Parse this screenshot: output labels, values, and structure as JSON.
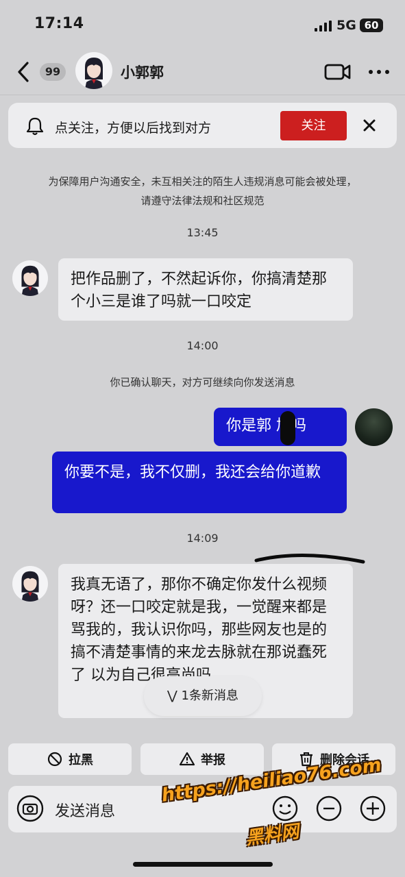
{
  "status_bar": {
    "time": "17:14",
    "network": "5G",
    "battery": "60"
  },
  "header": {
    "unread_count": "99",
    "contact_name": "小郭郭"
  },
  "follow_banner": {
    "text": "点关注，方便以后找到对方",
    "follow_label": "关注"
  },
  "notice": "为保障用户沟通安全，未互相关注的陌生人违规消息可能会被处理，请遵守法律法规和社区规范",
  "messages": [
    {
      "type": "time",
      "text": "13:45"
    },
    {
      "type": "incoming",
      "text": "把作品删了，不然起诉你，你搞清楚那个小三是谁了吗就一口咬定"
    },
    {
      "type": "time",
      "text": "14:00"
    },
    {
      "type": "system",
      "text": "你已确认聊天，对方可继续向你发送消息"
    },
    {
      "type": "outgoing",
      "text": "你是郭 旭吗"
    },
    {
      "type": "outgoing",
      "text": "你要不是，我不仅删，我还会给你道歉"
    },
    {
      "type": "time",
      "text": "14:09"
    },
    {
      "type": "incoming",
      "text": "我真无语了，那你不确定你发什么视频呀？还一口咬定就是我，一觉醒来都是骂我的，我认识你吗，那些网友也是的 搞不清楚事情的来龙去脉就在那说蠢死了  以为自己很高尚吗"
    }
  ],
  "new_messages_pill": "1条新消息",
  "actions": {
    "block": "拉黑",
    "report": "举报",
    "delete": "删除会话"
  },
  "input": {
    "placeholder": "发送消息"
  },
  "watermark": {
    "url": "https://heiliao76.com",
    "name": "黑料网"
  },
  "colors": {
    "accent_red": "#cc1f1f",
    "outgoing_bubble": "#1818cc",
    "background": "#d2d2d4"
  }
}
